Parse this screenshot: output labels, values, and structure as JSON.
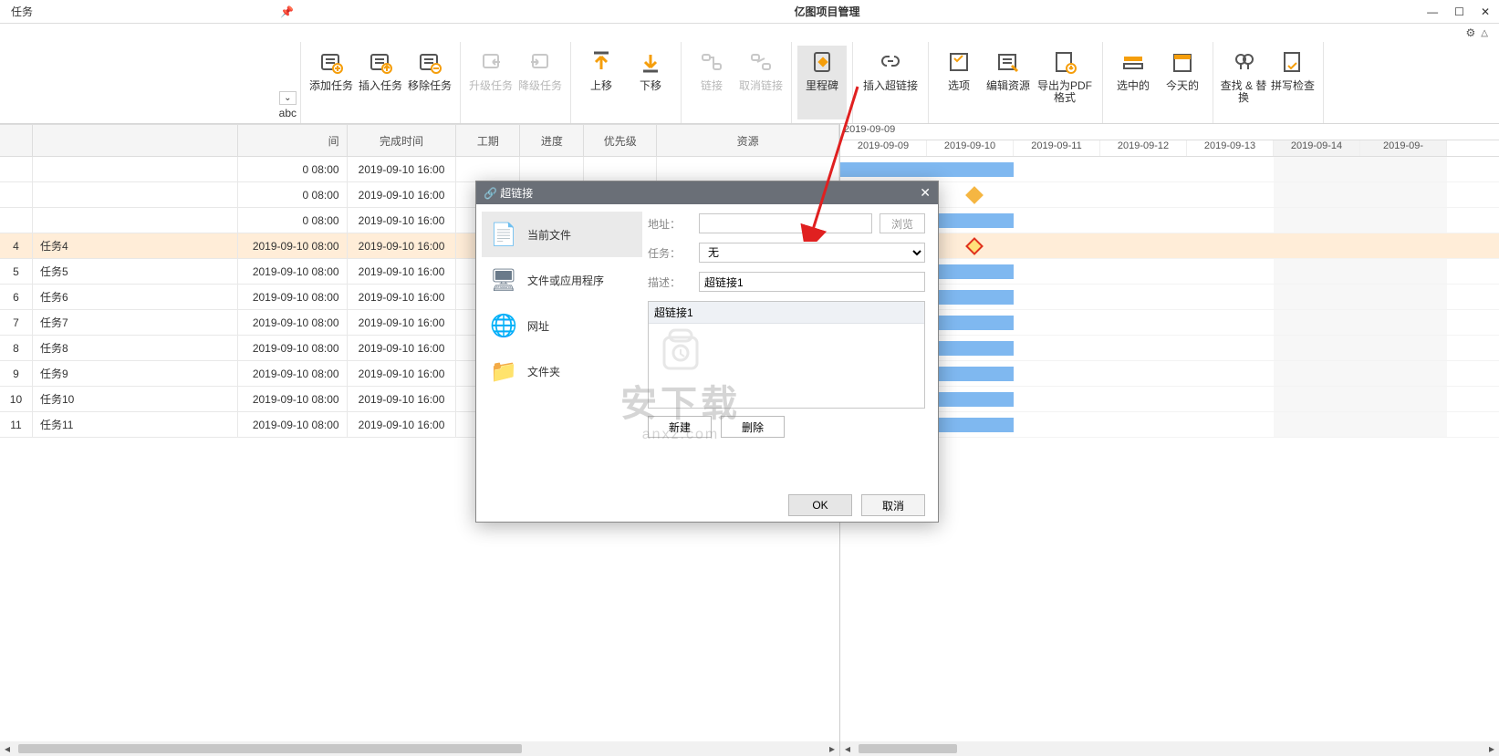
{
  "title_left": "任务",
  "app_title": "亿图项目管理",
  "abc": "abc",
  "ribbon": [
    {
      "label": "添加任务",
      "id": "add-task"
    },
    {
      "label": "插入任务",
      "id": "insert-task"
    },
    {
      "label": "移除任务",
      "id": "remove-task"
    },
    {
      "label": "升级任务",
      "id": "promote",
      "disabled": true
    },
    {
      "label": "降级任务",
      "id": "demote",
      "disabled": true
    },
    {
      "label": "上移",
      "id": "move-up"
    },
    {
      "label": "下移",
      "id": "move-down"
    },
    {
      "label": "链接",
      "id": "link",
      "disabled": true
    },
    {
      "label": "取消链接",
      "id": "unlink",
      "disabled": true
    },
    {
      "label": "里程碑",
      "id": "milestone",
      "active": true
    },
    {
      "label": "插入超链接",
      "id": "hyperlink",
      "wide": true
    },
    {
      "label": "选项",
      "id": "options"
    },
    {
      "label": "编辑资源",
      "id": "edit-res"
    },
    {
      "label": "导出为PDF格式",
      "id": "export-pdf",
      "wide": true
    },
    {
      "label": "选中的",
      "id": "selected"
    },
    {
      "label": "今天的",
      "id": "today"
    },
    {
      "label": "查找 & 替换",
      "id": "find-replace"
    },
    {
      "label": "拼写检查",
      "id": "spell"
    }
  ],
  "columns": {
    "time": "间",
    "end": "完成时间",
    "dur": "工期",
    "prog": "进度",
    "prio": "优先级",
    "res": "资源"
  },
  "rows": [
    {
      "idx": "",
      "name": "",
      "start": "0 08:00",
      "end": "2019-09-10 16:00"
    },
    {
      "idx": "",
      "name": "",
      "start": "0 08:00",
      "end": "2019-09-10 16:00"
    },
    {
      "idx": "",
      "name": "",
      "start": "0 08:00",
      "end": "2019-09-10 16:00"
    },
    {
      "idx": "4",
      "name": "任务4",
      "start": "2019-09-10 08:00",
      "end": "2019-09-10 16:00",
      "sel": true
    },
    {
      "idx": "5",
      "name": "任务5",
      "start": "2019-09-10 08:00",
      "end": "2019-09-10 16:00"
    },
    {
      "idx": "6",
      "name": "任务6",
      "start": "2019-09-10 08:00",
      "end": "2019-09-10 16:00"
    },
    {
      "idx": "7",
      "name": "任务7",
      "start": "2019-09-10 08:00",
      "end": "2019-09-10 16:00"
    },
    {
      "idx": "8",
      "name": "任务8",
      "start": "2019-09-10 08:00",
      "end": "2019-09-10 16:00"
    },
    {
      "idx": "9",
      "name": "任务9",
      "start": "2019-09-10 08:00",
      "end": "2019-09-10 16:00"
    },
    {
      "idx": "10",
      "name": "任务10",
      "start": "2019-09-10 08:00",
      "end": "2019-09-10 16:00"
    },
    {
      "idx": "11",
      "name": "任务11",
      "start": "2019-09-10 08:00",
      "end": "2019-09-10 16:00"
    }
  ],
  "gantt": {
    "top": "2019-09-09",
    "days": [
      "2019-09-09",
      "2019-09-10",
      "2019-09-11",
      "2019-09-12",
      "2019-09-13",
      "2019-09-14",
      "2019-09-"
    ]
  },
  "dialog": {
    "title": "超链接",
    "side": [
      "当前文件",
      "文件或应用程序",
      "网址",
      "文件夹"
    ],
    "labels": {
      "addr": "地址：",
      "task": "任务：",
      "desc": "描述："
    },
    "browse": "浏览",
    "task_val": "无",
    "desc_val": "超链接1",
    "list_item": "超链接1",
    "new": "新建",
    "del": "删除",
    "ok": "OK",
    "cancel": "取消"
  },
  "watermark": {
    "big": "安下载",
    "sm": "anxz.com"
  }
}
